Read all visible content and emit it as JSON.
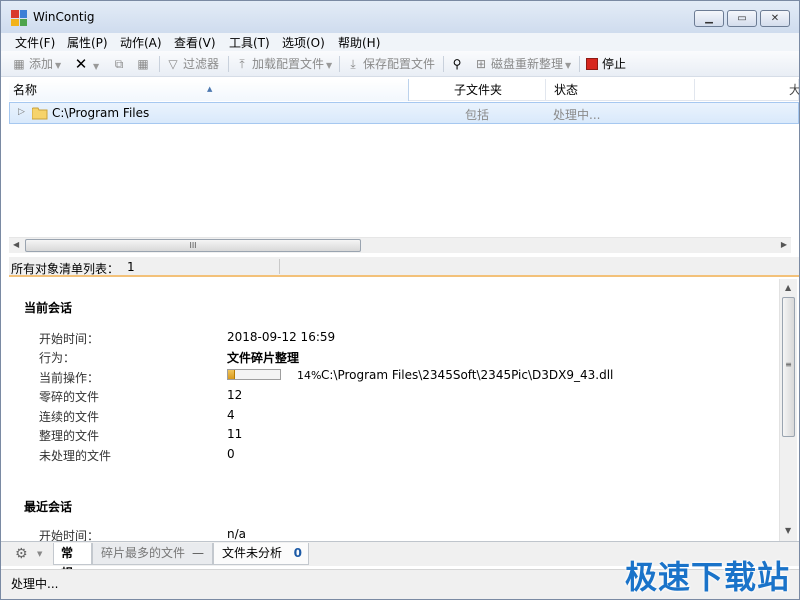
{
  "window": {
    "title": "WinContig"
  },
  "menu": [
    "文件(F)",
    "属性(P)",
    "动作(A)",
    "查看(V)",
    "工具(T)",
    "选项(O)",
    "帮助(H)"
  ],
  "toolbar": {
    "add": "添加",
    "filter": "过滤器",
    "load_profile": "加载配置文件",
    "save_profile": "保存配置文件",
    "disk_rearrange": "磁盘重新整理",
    "stop": "停止"
  },
  "columns": {
    "name": "名称",
    "subfolders": "子文件夹",
    "status": "状态",
    "more": "大"
  },
  "tree": [
    {
      "name": "C:\\Program Files",
      "subfolders": "包括",
      "status": "处理中..."
    }
  ],
  "object_list": {
    "label": "所有对象清单列表：",
    "count": "1"
  },
  "current_session": {
    "title": "当前会话",
    "start_time_label": "开始时间：",
    "start_time": "2018-09-12 16:59",
    "action_label": "行为：",
    "action": "文件碎片整理",
    "current_op_label": "当前操作：",
    "progress_percent": 14,
    "progress_text": "14%",
    "current_file": "C:\\Program Files\\2345Soft\\2345Pic\\D3DX9_43.dll",
    "fragmented_label": "零碎的文件",
    "fragmented": "12",
    "contiguous_label": "连续的文件",
    "contiguous": "4",
    "defragged_label": "整理的文件",
    "defragged": "11",
    "unprocessed_label": "未处理的文件",
    "unprocessed": "0"
  },
  "recent_session": {
    "title": "最近会话",
    "start_time_label": "开始时间：",
    "start_time": "n/a"
  },
  "tabs": {
    "general": "常规",
    "most_fragmented": "碎片最多的文件",
    "most_fragmented_dash": "—",
    "unanalyzed": "文件未分析",
    "unanalyzed_count": "0"
  },
  "status": {
    "text": "处理中..."
  },
  "watermark": "极速下载站",
  "colors": {
    "accent_orange": "#f3c179",
    "selection_border": "#a6c8f0",
    "progress_fill": "#d89a1e",
    "stop_red": "#d7261e",
    "watermark_blue": "#1a73c9"
  }
}
